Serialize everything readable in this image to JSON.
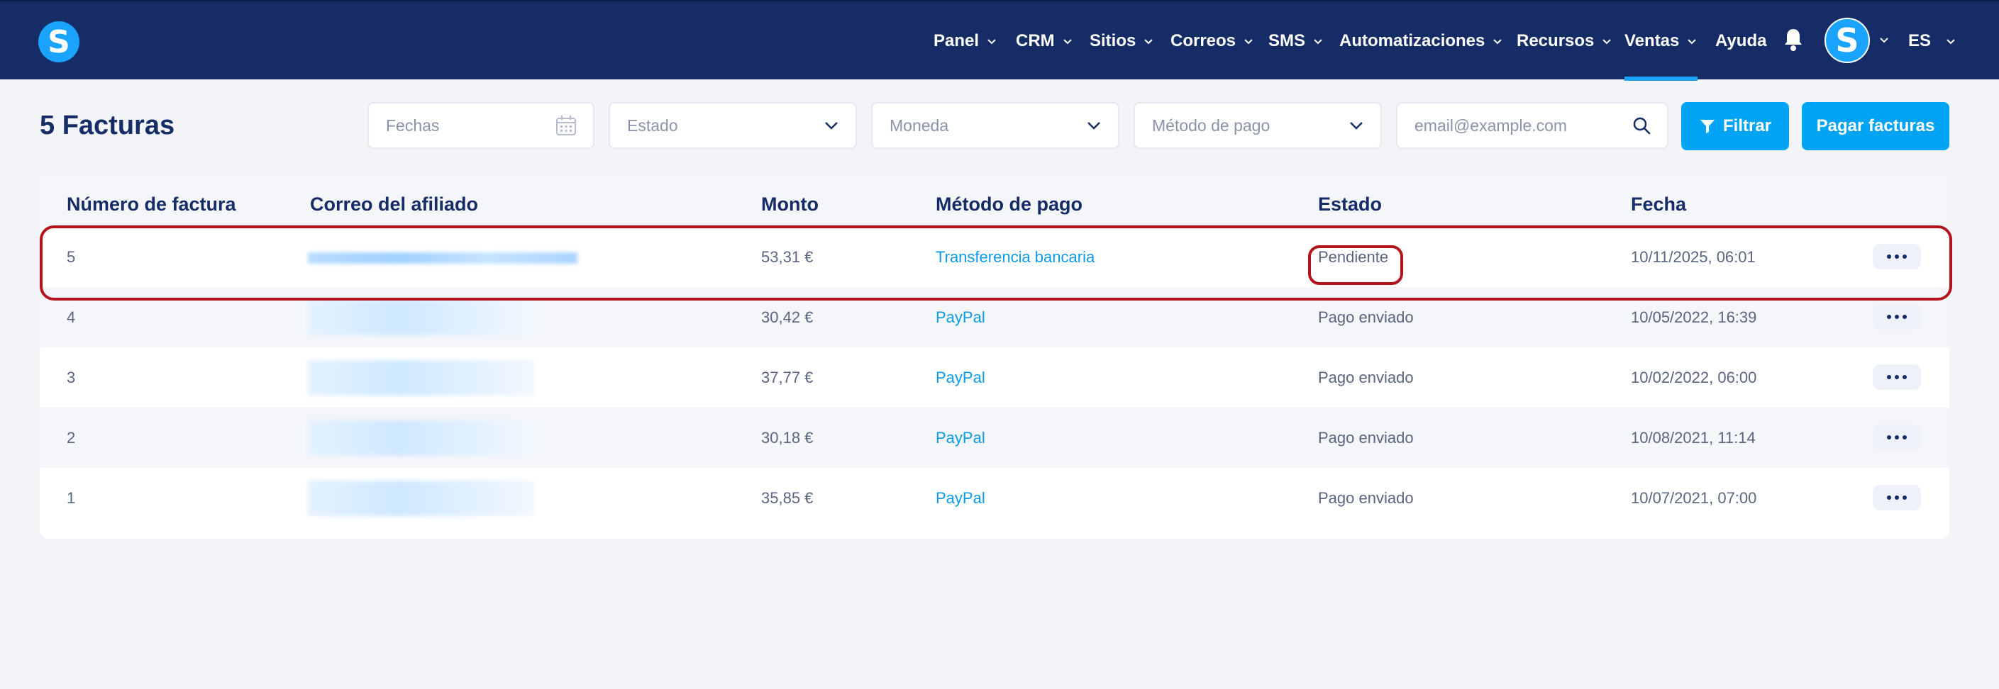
{
  "nav": {
    "logo_letter": "S",
    "items": [
      {
        "label": "Panel"
      },
      {
        "label": "CRM"
      },
      {
        "label": "Sitios"
      },
      {
        "label": "Correos"
      },
      {
        "label": "SMS"
      },
      {
        "label": "Automatizaciones"
      },
      {
        "label": "Recursos"
      },
      {
        "label": "Ventas",
        "active": true
      },
      {
        "label": "Ayuda"
      }
    ],
    "avatar_letter": "S",
    "language": "ES"
  },
  "toolbar": {
    "title": "5 Facturas",
    "dates_placeholder": "Fechas",
    "status_placeholder": "Estado",
    "currency_placeholder": "Moneda",
    "payment_method_placeholder": "Método de pago",
    "email_placeholder": "email@example.com",
    "filter_label": "Filtrar",
    "pay_label": "Pagar facturas"
  },
  "table": {
    "columns": [
      "Número de factura",
      "Correo del afiliado",
      "Monto",
      "Método de pago",
      "Estado",
      "Fecha"
    ],
    "rows": [
      {
        "number": "5",
        "amount": "53,31 €",
        "method": "Transferencia bancaria",
        "status": "Pendiente",
        "date": "10/11/2025, 06:01"
      },
      {
        "number": "4",
        "amount": "30,42 €",
        "method": "PayPal",
        "status": "Pago enviado",
        "date": "10/05/2022, 16:39"
      },
      {
        "number": "3",
        "amount": "37,77 €",
        "method": "PayPal",
        "status": "Pago enviado",
        "date": "10/02/2022, 06:00"
      },
      {
        "number": "2",
        "amount": "30,18 €",
        "method": "PayPal",
        "status": "Pago enviado",
        "date": "10/08/2021, 11:14"
      },
      {
        "number": "1",
        "amount": "35,85 €",
        "method": "PayPal",
        "status": "Pago enviado",
        "date": "10/07/2021, 07:00"
      }
    ]
  },
  "colors": {
    "nav_bg": "#152c66",
    "accent": "#00a4f5",
    "link": "#0a9be6",
    "highlight": "#b3141b"
  }
}
